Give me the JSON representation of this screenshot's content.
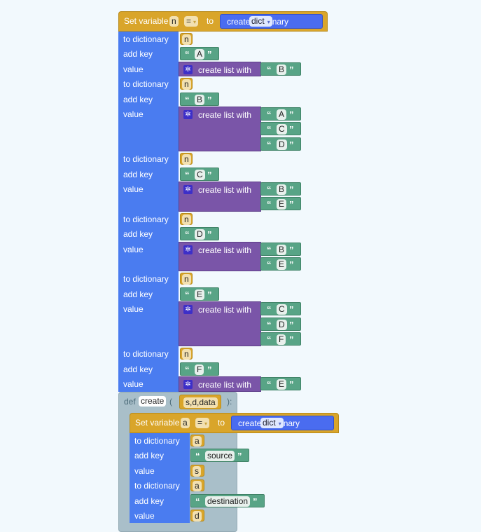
{
  "setBlock": {
    "label": "Set variable",
    "variable": "n",
    "operator": "=",
    "dropdown_arrow": "▾",
    "to": "to",
    "create": "create dictionary",
    "dict": "dict"
  },
  "labels": {
    "to_dictionary": "to dictionary",
    "add_key": "add key",
    "value": "value",
    "create_list": "create list with",
    "quote_open": "“",
    "quote_close": "”"
  },
  "entries": [
    {
      "dict": "n",
      "key": "A",
      "items": [
        "B"
      ]
    },
    {
      "dict": "n",
      "key": "B",
      "items": [
        "A",
        "C",
        "D"
      ]
    },
    {
      "dict": "n",
      "key": "C",
      "items": [
        "B",
        "E"
      ]
    },
    {
      "dict": "n",
      "key": "D",
      "items": [
        "B",
        "E"
      ]
    },
    {
      "dict": "n",
      "key": "E",
      "items": [
        "C",
        "D",
        "F"
      ]
    },
    {
      "dict": "n",
      "key": "F",
      "items": [
        "E"
      ]
    }
  ],
  "def": {
    "keyword": "def",
    "name": "create",
    "open_paren": "(",
    "params": "s,d,data",
    "close_paren": "):"
  },
  "innerSet": {
    "label": "Set variable",
    "variable": "a",
    "operator": "=",
    "dropdown_arrow": "▾",
    "to": "to",
    "create": "create dictionary",
    "dict": "dict"
  },
  "innerEntries": [
    {
      "dict": "a",
      "key": "source",
      "value": "s"
    },
    {
      "dict": "a",
      "key": "destination",
      "value": "d"
    }
  ],
  "colors": {
    "set_block": "#d9a52a",
    "dict_block": "#4a7cf0",
    "list_block": "#7a55a8",
    "text_block": "#58a486",
    "def_block": "#a9bfc9",
    "workspace": "#f2f9fd"
  },
  "icons": {
    "gear": "gear-icon"
  }
}
